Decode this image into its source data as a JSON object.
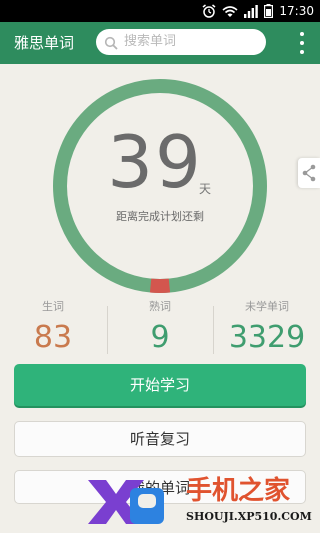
{
  "status_bar": {
    "time": "17:30",
    "icons": [
      "alarm-icon",
      "wifi-icon",
      "signal-icon",
      "battery-icon"
    ]
  },
  "app_bar": {
    "title": "雅思单词",
    "search_placeholder": "搜索单词",
    "menu_icon": "more-vert-icon",
    "color": "#2e8c5e"
  },
  "plan": {
    "days_left": "39",
    "unit": "天",
    "caption": "距离完成计划还剩",
    "progress": 0.03
  },
  "stats": [
    {
      "label": "生词",
      "value": "83",
      "color": "#c97a4e"
    },
    {
      "label": "熟词",
      "value": "9",
      "color": "#3f9d6f"
    },
    {
      "label": "未学单词",
      "value": "3329",
      "color": "#3f9d6f"
    }
  ],
  "actions": {
    "start": "开始学习",
    "review": "听音复习",
    "third": "我的单词"
  },
  "watermark": {
    "brand": "手机之家",
    "url": "SHOUJI.XP510.COM"
  },
  "colors": {
    "ring": "#6aab80",
    "accent_button": "#2fb37a"
  }
}
